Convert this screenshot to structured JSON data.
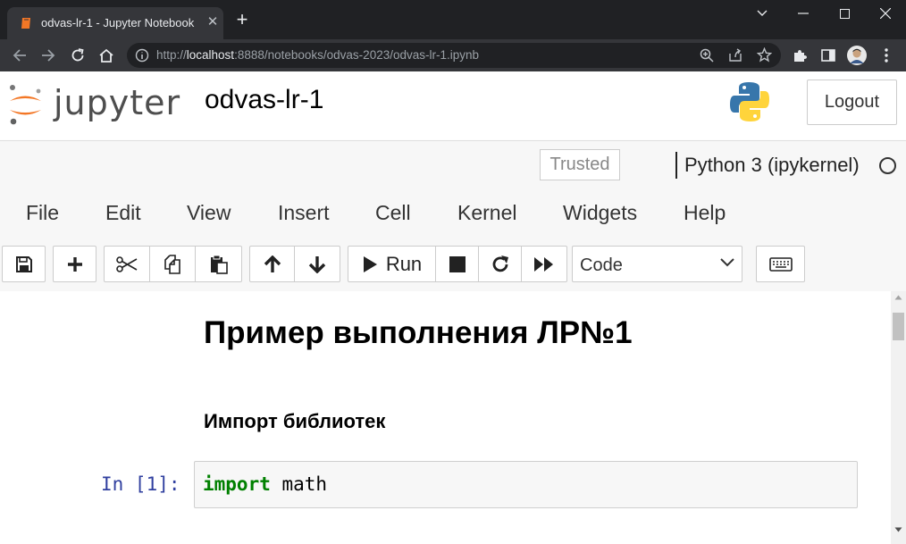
{
  "browser": {
    "tab_title": "odvas-lr-1 - Jupyter Notebook",
    "url_prefix": "http://",
    "url_host": "localhost",
    "url_rest": ":8888/notebooks/odvas-2023/odvas-lr-1.ipynb"
  },
  "header": {
    "logo_text": "jupyter",
    "notebook_name": "odvas-lr-1",
    "logout_label": "Logout"
  },
  "status": {
    "trusted_label": "Trusted",
    "kernel_name": "Python 3 (ipykernel)"
  },
  "menu": [
    "File",
    "Edit",
    "View",
    "Insert",
    "Cell",
    "Kernel",
    "Widgets",
    "Help"
  ],
  "toolbar": {
    "run_label": "Run",
    "cell_type": "Code",
    "icons": [
      "save-icon",
      "add-cell-icon",
      "cut-icon",
      "copy-icon",
      "paste-icon",
      "move-up-icon",
      "move-down-icon",
      "run-icon",
      "stop-icon",
      "restart-icon",
      "fast-forward-icon",
      "keyboard-icon"
    ]
  },
  "notebook": {
    "heading1": "Пример выполнения ЛР№1",
    "heading3": "Импорт библиотек",
    "cell_prompt": "In [1]:",
    "code_keyword": "import",
    "code_rest": " math"
  },
  "colors": {
    "browser_dark": "#202124",
    "browser_tab": "#35363a",
    "jupyter_orange": "#f37726",
    "prompt_blue": "#303f9f",
    "keyword_green": "#008000"
  }
}
